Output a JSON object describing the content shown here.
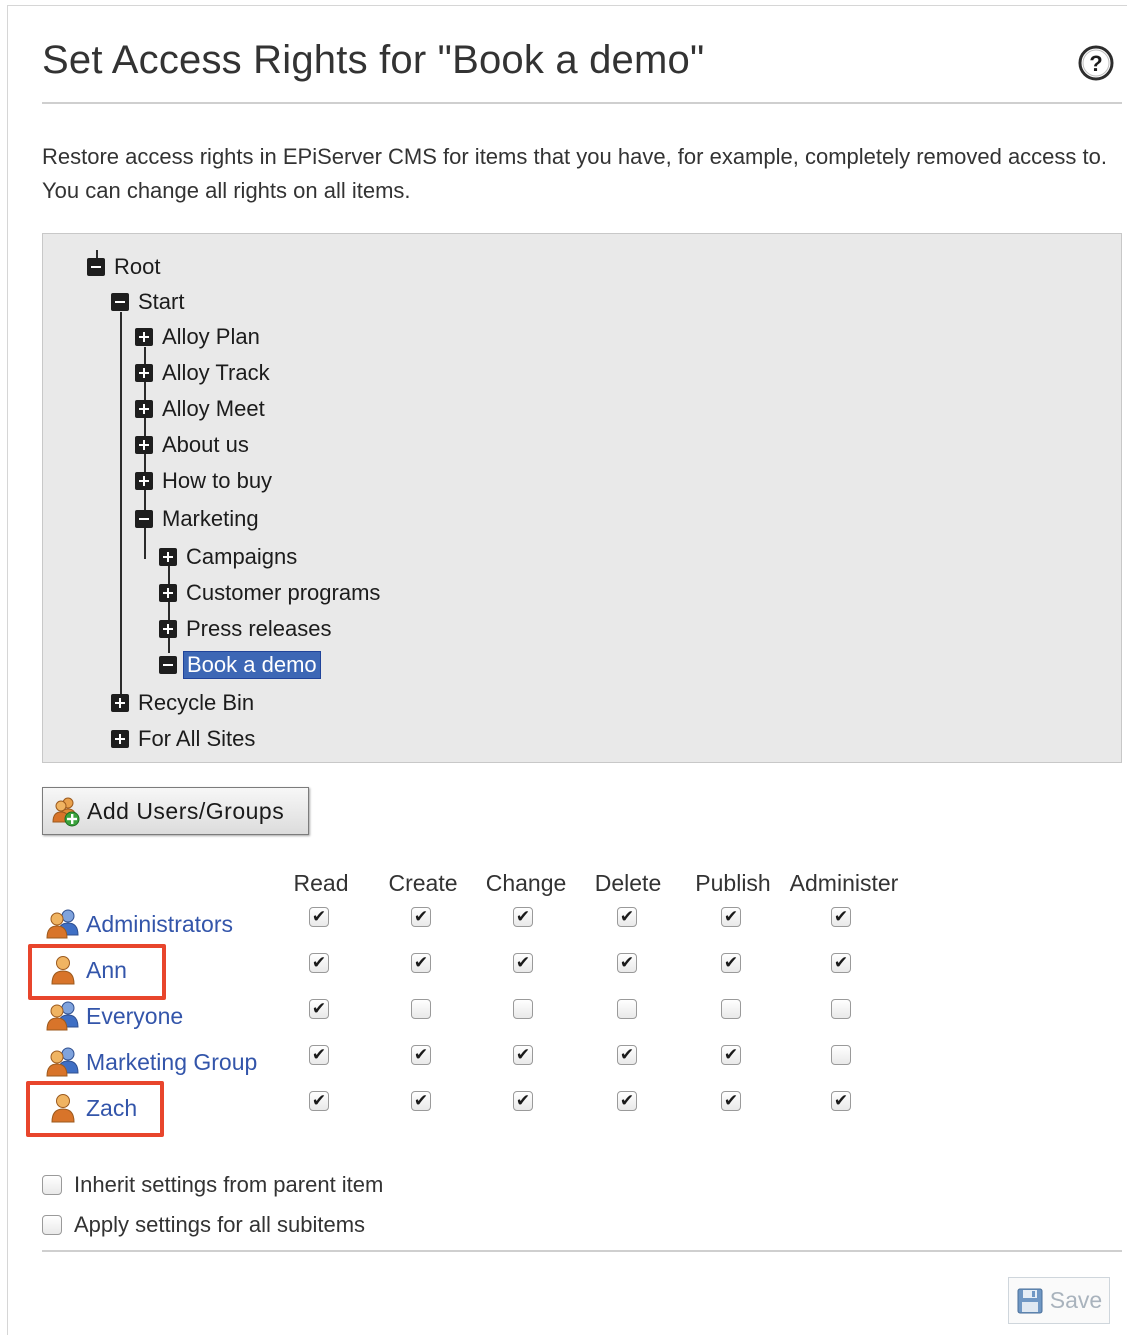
{
  "dialog": {
    "title": "Set Access Rights for \"Book a demo\"",
    "description": "Restore access rights in EPiServer CMS for items that you have, for example, completely removed access to. You can change all rights on all items."
  },
  "tree": {
    "root": "Root",
    "start": "Start",
    "alloy_plan": "Alloy Plan",
    "alloy_track": "Alloy Track",
    "alloy_meet": "Alloy Meet",
    "about_us": "About us",
    "how_to_buy": "How to buy",
    "marketing": "Marketing",
    "campaigns": "Campaigns",
    "customer_programs": "Customer programs",
    "press_releases": "Press releases",
    "book_a_demo": "Book a demo",
    "recycle_bin": "Recycle Bin",
    "for_all_sites": "For All Sites"
  },
  "add_button_label": "Add Users/Groups",
  "permissions": {
    "columns": [
      "Read",
      "Create",
      "Change",
      "Delete",
      "Publish",
      "Administer"
    ],
    "rows": [
      {
        "name": "Administrators",
        "type": "group",
        "highlighted": false,
        "checks": [
          true,
          true,
          true,
          true,
          true,
          true
        ]
      },
      {
        "name": "Ann",
        "type": "user",
        "highlighted": true,
        "checks": [
          true,
          true,
          true,
          true,
          true,
          true
        ]
      },
      {
        "name": "Everyone",
        "type": "group",
        "highlighted": false,
        "checks": [
          true,
          false,
          false,
          false,
          false,
          false
        ]
      },
      {
        "name": "Marketing Group",
        "type": "group",
        "highlighted": false,
        "checks": [
          true,
          true,
          true,
          true,
          true,
          false
        ]
      },
      {
        "name": "Zach",
        "type": "user",
        "highlighted": true,
        "checks": [
          true,
          true,
          true,
          true,
          true,
          true
        ]
      }
    ]
  },
  "options": {
    "inherit_label": "Inherit settings from parent item",
    "inherit_checked": false,
    "apply_label": "Apply settings for all subitems",
    "apply_checked": false
  },
  "save_label": "Save",
  "colors": {
    "highlight": "#e8452c",
    "link": "#3355aa",
    "selection": "#3d67b5"
  },
  "icons": {
    "help": "help-icon",
    "add": "add-users-icon",
    "group": "group-icon",
    "user": "user-icon",
    "save": "floppy-disk-icon"
  }
}
